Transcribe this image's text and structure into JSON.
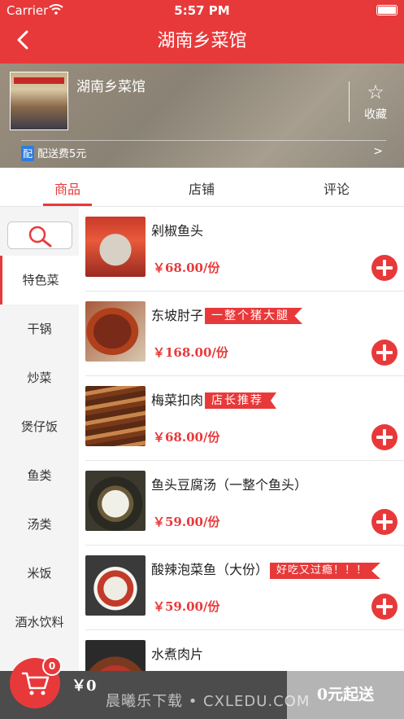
{
  "status_bar": {
    "carrier": "Carrier",
    "time": "5:57 PM"
  },
  "nav": {
    "title": "湖南乡菜馆"
  },
  "shop": {
    "name": "湖南乡菜馆",
    "favorite_label": "收藏",
    "delivery_tag": "配",
    "delivery_text": "配送费5元",
    "arrow": ">"
  },
  "tabs": [
    {
      "label": "商品",
      "active": true
    },
    {
      "label": "店铺",
      "active": false
    },
    {
      "label": "评论",
      "active": false
    }
  ],
  "categories": [
    {
      "label": "特色菜",
      "active": true
    },
    {
      "label": "干锅"
    },
    {
      "label": "炒菜"
    },
    {
      "label": "煲仔饭"
    },
    {
      "label": "鱼类"
    },
    {
      "label": "汤类"
    },
    {
      "label": "米饭"
    },
    {
      "label": "酒水饮料"
    }
  ],
  "products": [
    {
      "name": "剁椒鱼头",
      "badge": "",
      "price": "￥68.00/份"
    },
    {
      "name": "东坡肘子",
      "badge": "一整个猪大腿",
      "price": "￥168.00/份"
    },
    {
      "name": "梅菜扣肉",
      "badge": "店长推荐",
      "price": "￥68.00/份"
    },
    {
      "name": "鱼头豆腐汤（一整个鱼头）",
      "badge": "",
      "price": "￥59.00/份"
    },
    {
      "name": "酸辣泡菜鱼（大份）",
      "badge": "好吃又过瘾！！！",
      "price": "￥59.00/份"
    },
    {
      "name": "水煮肉片",
      "badge": "",
      "price": ""
    }
  ],
  "cart": {
    "count": "0",
    "total": "￥0",
    "submit_label": "0元起送"
  },
  "watermark": "晨曦乐下载 • CXLEDU.COM",
  "colors": {
    "accent": "#e8393a",
    "cart_bar": "#4c4c4c",
    "submit_disabled": "#b4b4b4"
  }
}
